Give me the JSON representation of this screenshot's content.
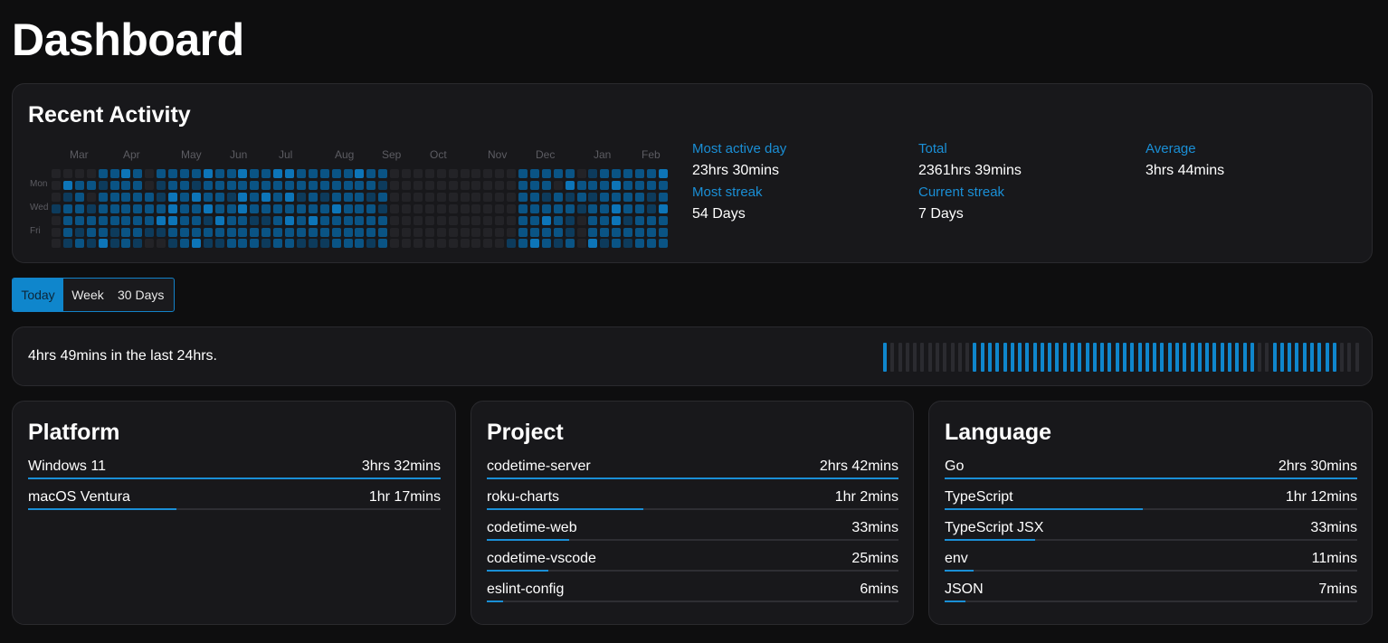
{
  "page": {
    "title": "Dashboard"
  },
  "colors": {
    "accent": "#1a8fd6",
    "heat_levels": [
      "#232327",
      "#0d3b5c",
      "#0a5485",
      "#0d75b8",
      "#1597e0"
    ],
    "hour_active": "#0f86cc",
    "hour_inactive": "#2b2b30"
  },
  "recent_activity": {
    "title": "Recent Activity",
    "months": [
      "Mar",
      "Apr",
      "May",
      "Jun",
      "Jul",
      "Aug",
      "Sep",
      "Oct",
      "Nov",
      "Dec",
      "Jan",
      "Feb"
    ],
    "day_labels": [
      "Mon",
      "Wed",
      "Fri"
    ],
    "heatmap_weeks": 53,
    "heatmap_levels": [
      [
        0,
        0,
        0,
        1,
        0,
        0,
        0
      ],
      [
        0,
        3,
        1,
        2,
        2,
        2,
        1
      ],
      [
        0,
        2,
        2,
        2,
        2,
        1,
        2
      ],
      [
        0,
        2,
        0,
        1,
        2,
        2,
        1
      ],
      [
        2,
        1,
        2,
        2,
        2,
        2,
        3
      ],
      [
        2,
        2,
        2,
        2,
        2,
        1,
        1
      ],
      [
        3,
        2,
        2,
        2,
        2,
        2,
        2
      ],
      [
        2,
        2,
        2,
        2,
        2,
        2,
        1
      ],
      [
        0,
        0,
        2,
        2,
        2,
        1,
        0
      ],
      [
        2,
        1,
        1,
        2,
        3,
        1,
        0
      ],
      [
        2,
        2,
        3,
        3,
        3,
        2,
        1
      ],
      [
        2,
        2,
        2,
        2,
        2,
        2,
        2
      ],
      [
        2,
        1,
        3,
        2,
        2,
        2,
        3
      ],
      [
        3,
        2,
        2,
        3,
        1,
        2,
        1
      ],
      [
        2,
        2,
        2,
        2,
        3,
        2,
        1
      ],
      [
        2,
        2,
        1,
        2,
        2,
        2,
        2
      ],
      [
        3,
        2,
        3,
        3,
        2,
        2,
        2
      ],
      [
        2,
        2,
        2,
        2,
        1,
        2,
        2
      ],
      [
        2,
        2,
        3,
        2,
        1,
        2,
        1
      ],
      [
        3,
        2,
        2,
        2,
        2,
        2,
        2
      ],
      [
        3,
        2,
        3,
        2,
        3,
        2,
        2
      ],
      [
        2,
        2,
        1,
        2,
        2,
        2,
        1
      ],
      [
        2,
        2,
        2,
        2,
        3,
        2,
        1
      ],
      [
        2,
        2,
        1,
        2,
        2,
        2,
        1
      ],
      [
        2,
        2,
        2,
        3,
        2,
        2,
        2
      ],
      [
        2,
        2,
        2,
        2,
        2,
        2,
        2
      ],
      [
        3,
        2,
        2,
        2,
        2,
        2,
        2
      ],
      [
        2,
        2,
        1,
        2,
        2,
        2,
        1
      ],
      [
        2,
        1,
        2,
        1,
        2,
        2,
        2
      ],
      [
        0,
        0,
        0,
        0,
        0,
        0,
        0
      ],
      [
        0,
        0,
        0,
        0,
        0,
        0,
        0
      ],
      [
        0,
        0,
        0,
        0,
        0,
        0,
        0
      ],
      [
        0,
        0,
        0,
        0,
        0,
        0,
        0
      ],
      [
        0,
        0,
        0,
        0,
        0,
        0,
        0
      ],
      [
        0,
        0,
        0,
        0,
        0,
        0,
        0
      ],
      [
        0,
        0,
        0,
        0,
        0,
        0,
        0
      ],
      [
        0,
        0,
        0,
        0,
        0,
        0,
        0
      ],
      [
        0,
        0,
        0,
        0,
        0,
        0,
        0
      ],
      [
        0,
        0,
        0,
        0,
        0,
        0,
        0
      ],
      [
        0,
        0,
        0,
        0,
        0,
        0,
        1
      ],
      [
        2,
        2,
        2,
        2,
        2,
        2,
        2
      ],
      [
        2,
        2,
        2,
        2,
        2,
        2,
        3
      ],
      [
        2,
        2,
        1,
        2,
        3,
        2,
        2
      ],
      [
        2,
        0,
        2,
        2,
        2,
        2,
        1
      ],
      [
        2,
        3,
        1,
        2,
        1,
        1,
        2
      ],
      [
        0,
        2,
        2,
        1,
        0,
        0,
        0
      ],
      [
        1,
        2,
        1,
        2,
        2,
        2,
        3
      ],
      [
        2,
        2,
        2,
        2,
        2,
        2,
        1
      ],
      [
        2,
        3,
        2,
        3,
        3,
        2,
        2
      ],
      [
        2,
        2,
        2,
        2,
        1,
        2,
        1
      ],
      [
        2,
        2,
        2,
        2,
        2,
        2,
        2
      ],
      [
        2,
        2,
        1,
        1,
        2,
        2,
        2
      ],
      [
        3,
        2,
        2,
        3,
        2,
        2,
        2
      ]
    ],
    "stats": {
      "most_active_day": {
        "label": "Most active day",
        "value": "23hrs 30mins"
      },
      "total": {
        "label": "Total",
        "value": "2361hrs 39mins"
      },
      "average": {
        "label": "Average",
        "value": "3hrs 44mins"
      },
      "most_streak": {
        "label": "Most streak",
        "value": "54 Days"
      },
      "current_streak": {
        "label": "Current streak",
        "value": "7 Days"
      }
    }
  },
  "range_tabs": [
    {
      "label": "Today",
      "active": true
    },
    {
      "label": "Week",
      "active": false
    },
    {
      "label": "30 Days",
      "active": false
    }
  ],
  "last24": {
    "summary": "4hrs 49mins in the last 24hrs.",
    "hour_bars": [
      1,
      0,
      0,
      0,
      0,
      0,
      0,
      0,
      0,
      0,
      0,
      0,
      1,
      1,
      1,
      1,
      1,
      1,
      1,
      1,
      1,
      1,
      1,
      1,
      1,
      1,
      1,
      1,
      1,
      1,
      1,
      1,
      1,
      1,
      1,
      1,
      1,
      1,
      1,
      1,
      1,
      1,
      1,
      1,
      1,
      1,
      1,
      1,
      1,
      1,
      0,
      0,
      1,
      1,
      1,
      1,
      1,
      1,
      1,
      1,
      1,
      0,
      0,
      0
    ]
  },
  "platform": {
    "title": "Platform",
    "items": [
      {
        "name": "Windows 11",
        "time": "3hrs 32mins",
        "share": 1.0
      },
      {
        "name": "macOS Ventura",
        "time": "1hr 17mins",
        "share": 0.36
      }
    ]
  },
  "project": {
    "title": "Project",
    "items": [
      {
        "name": "codetime-server",
        "time": "2hrs 42mins",
        "share": 1.0
      },
      {
        "name": "roku-charts",
        "time": "1hr 2mins",
        "share": 0.38
      },
      {
        "name": "codetime-web",
        "time": "33mins",
        "share": 0.2
      },
      {
        "name": "codetime-vscode",
        "time": "25mins",
        "share": 0.15
      },
      {
        "name": "eslint-config",
        "time": "6mins",
        "share": 0.04
      }
    ]
  },
  "language": {
    "title": "Language",
    "items": [
      {
        "name": "Go",
        "time": "2hrs 30mins",
        "share": 1.0
      },
      {
        "name": "TypeScript",
        "time": "1hr 12mins",
        "share": 0.48
      },
      {
        "name": "TypeScript JSX",
        "time": "33mins",
        "share": 0.22
      },
      {
        "name": "env",
        "time": "11mins",
        "share": 0.07
      },
      {
        "name": "JSON",
        "time": "7mins",
        "share": 0.05
      }
    ]
  }
}
